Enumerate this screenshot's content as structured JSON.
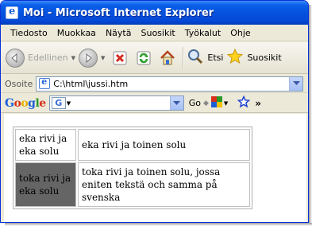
{
  "window": {
    "title": "Moi - Microsoft Internet Explorer"
  },
  "menubar": {
    "items": [
      "Tiedosto",
      "Muokkaa",
      "Näytä",
      "Suosikit",
      "Työkalut",
      "Ohje"
    ]
  },
  "toolbar": {
    "back_label": "Edellinen",
    "search_label": "Etsi",
    "favorites_label": "Suosikit"
  },
  "address": {
    "label": "Osoite",
    "value": "C:\\html\\jussi.htm"
  },
  "googlebar": {
    "logo": "Google",
    "badge": "G",
    "go_label": "Go"
  },
  "page": {
    "table": {
      "rows": [
        {
          "cells": [
            "eka rivi ja eka solu",
            "eka rivi ja toinen solu"
          ]
        },
        {
          "cells": [
            "toka rivi ja eka solu",
            "toka rivi ja toinen solu, jossa eniten tekstä och samma på svenska"
          ]
        }
      ],
      "highlight_color": "#656565"
    }
  },
  "colors": {
    "titlebar": "#0553df",
    "chrome": "#ece9d8"
  }
}
